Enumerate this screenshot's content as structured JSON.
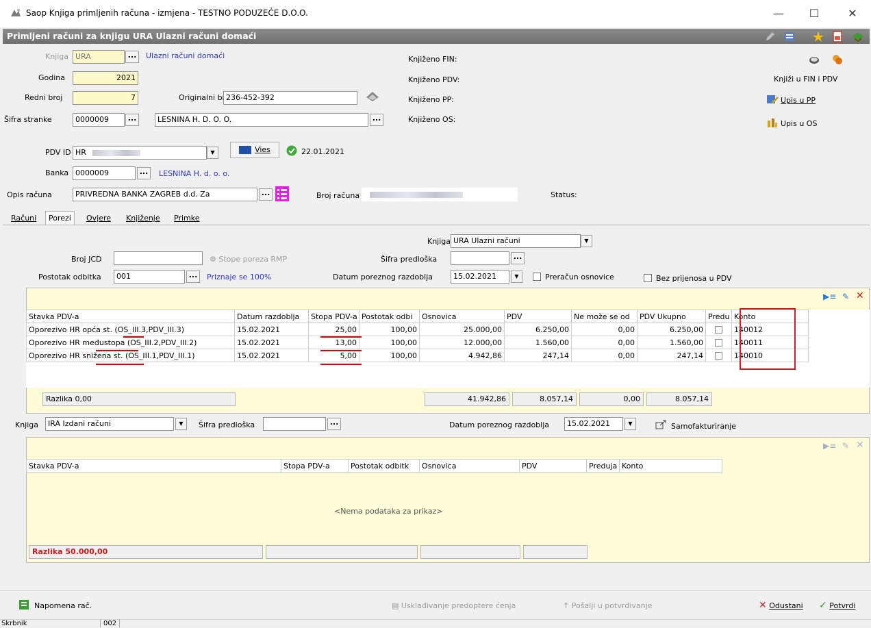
{
  "window": {
    "title": "Saop Knjiga primljenih računa - izmjena - TESTNO PODUZEĆE D.O.O.",
    "minimize": "—",
    "maximize": "☐",
    "close": "✕"
  },
  "header": {
    "title": "Primljeni računi za knjigu URA Ulazni računi domaći"
  },
  "form": {
    "knjiga_label": "Knjiga",
    "knjiga_value": "URA",
    "knjiga_link": "Ulazni računi domaći",
    "godina_label": "Godina",
    "godina_value": "2021",
    "redni_label": "Redni broj",
    "redni_value": "7",
    "originalni_label": "Originalni br.",
    "originalni_value": "236-452-392",
    "sifra_stranke_label": "Šifra stranke",
    "sifra_stranke_value": "0000009",
    "stranka_naziv": "LESNINA H. D. O. O.",
    "pdv_id_label": "PDV ID",
    "pdv_id_value": "HR",
    "vies_label": "Vies",
    "vies_date": "22.01.2021",
    "banka_label": "Banka",
    "banka_value": "0000009",
    "banka_link": "LESNINA H. d. o. o.",
    "opis_label": "Opis računa",
    "opis_value": "PRIVREDNA BANKA ZAGREB d.d. Za",
    "broj_racuna_label": "Broj računa",
    "status_label": "Status:",
    "dots": "..."
  },
  "knjizeno": {
    "fin": "Knjiženo FIN:",
    "pdv": "Knjiženo PDV:",
    "pp": "Knjiženo PP:",
    "os": "Knjiženo OS:"
  },
  "actions": {
    "knjizi": "Knjiži u FIN i PDV",
    "upis_pp": "Upis u PP",
    "upis_os": "Upis u OS"
  },
  "tabs": [
    "Računi",
    "Porezi",
    "Ovjere",
    "Knjiženje",
    "Primke"
  ],
  "porezi": {
    "knjiga_label": "Knjiga",
    "knjiga_value": "URA Ulazni računi",
    "broj_jcd_label": "Broj JCD",
    "stope_rmp": "Stope poreza RMP",
    "sifra_predloska_label": "Šifra predloška",
    "postotak_label": "Postotak odbitka",
    "postotak_value": "001",
    "priznaje": "Priznaje se 100%",
    "datum_label": "Datum poreznog razdoblja",
    "datum_value": "15.02.2021",
    "preracun": "Preračun osnovice",
    "bez_prijenosa": "Bez prijenosa u PDV"
  },
  "ura_table": {
    "columns": [
      "Stavka PDV-a",
      "Datum razdoblja",
      "Stopa PDV-a",
      "Postotak odbi",
      "Osnovica",
      "PDV",
      "Ne može se od",
      "PDV Ukupno",
      "Predu",
      "Konto"
    ],
    "rows": [
      {
        "stavka": "Oporezivo HR opća st. (OS_III.3,PDV_III.3)",
        "datum": "15.02.2021",
        "stopa": "25,00",
        "postotak": "100,00",
        "osnovica": "25.000,00",
        "pdv": "6.250,00",
        "ne_moze": "0,00",
        "ukupno": "6.250,00",
        "konto": "140012"
      },
      {
        "stavka": "Oporezivo HR međustopa (OS_III.2,PDV_III.2)",
        "datum": "15.02.2021",
        "stopa": "13,00",
        "postotak": "100,00",
        "osnovica": "12.000,00",
        "pdv": "1.560,00",
        "ne_moze": "0,00",
        "ukupno": "1.560,00",
        "konto": "140011"
      },
      {
        "stavka": "Oporezivo HR snižena st. (OS_III.1,PDV_III.1)",
        "datum": "15.02.2021",
        "stopa": "5,00",
        "postotak": "100,00",
        "osnovica": "4.942,86",
        "pdv": "247,14",
        "ne_moze": "0,00",
        "ukupno": "247,14",
        "konto": "140010"
      }
    ],
    "razlika": "Razlika 0,00",
    "sum_osnovica": "41.942,86",
    "sum_pdv": "8.057,14",
    "sum_ne_moze": "0,00",
    "sum_ukupno": "8.057,14"
  },
  "ira": {
    "knjiga_label": "Knjiga",
    "knjiga_value": "IRA Izdani računi",
    "sifra_label": "Šifra predloška",
    "datum_label": "Datum poreznog razdoblja",
    "datum_value": "15.02.2021",
    "samofakturiranje": "Samofakturiranje",
    "columns": [
      "Stavka PDV-a",
      "Stopa PDV-a",
      "Postotak odbitk",
      "Osnovica",
      "PDV",
      "Preduja",
      "Konto"
    ],
    "empty": "<Nema podataka za prikaz>",
    "razlika": "Razlika 50.000,00"
  },
  "bottom": {
    "napomena": "Napomena rač.",
    "uskladivanje": "Usklađivanje predoptere ćenja",
    "posalji": "Pošalji u potvrđivanje",
    "odustani": "Odustani",
    "potvrdi": "Potvrdi"
  },
  "statusbar": {
    "label": "Skrbnik",
    "value": "002"
  },
  "colors": {
    "accent_blue": "#2c35c9",
    "highlight_red": "#e00000",
    "yellow_field": "#fdf9c8",
    "panel_yellow": "#fdfbd8"
  }
}
